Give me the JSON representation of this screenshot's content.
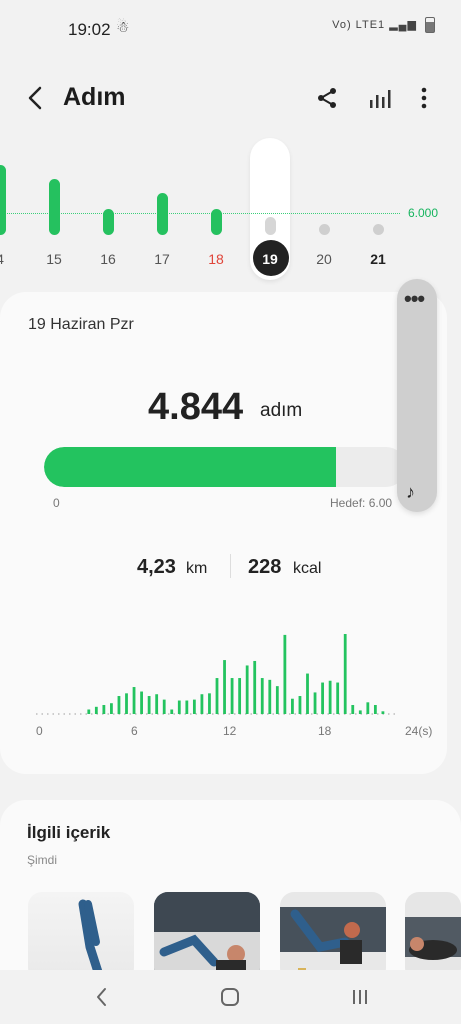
{
  "status": {
    "time": "19:02",
    "person_icon": "person-icon",
    "right": "Vo) LTE1"
  },
  "header": {
    "title": "Adım"
  },
  "week": {
    "target_label": "6.000",
    "days": [
      {
        "label": "4",
        "level": 0.88
      },
      {
        "label": "15",
        "level": 0.7
      },
      {
        "label": "16",
        "level": 0.32
      },
      {
        "label": "17",
        "level": 0.53
      },
      {
        "label": "18",
        "level": 0.33
      },
      {
        "label": "19",
        "level": 0.81
      },
      {
        "label": "20",
        "level": 0
      },
      {
        "label": "21",
        "level": 0
      }
    ]
  },
  "day": {
    "date_label": "19 Haziran Pzr",
    "steps": "4.844",
    "steps_unit": "adım",
    "progress": 0.807,
    "progress_start": "0",
    "progress_goal": "Hedef: 6.00",
    "distance": "4,23",
    "distance_unit": "km",
    "calories": "228",
    "calories_unit": "kcal"
  },
  "hourly": {
    "x_labels": [
      "0",
      "6",
      "12",
      "18",
      "24(s)"
    ],
    "values": [
      0,
      0,
      0,
      0,
      0,
      0,
      0,
      0.5,
      0.8,
      1,
      1.2,
      2,
      2.3,
      3,
      2.5,
      2,
      2.2,
      1.6,
      0.5,
      1.5,
      1.5,
      1.6,
      2.2,
      2.3,
      4,
      6,
      4,
      4,
      5.4,
      5.9,
      4,
      3.8,
      3.1,
      8.8,
      1.7,
      2,
      4.5,
      2.4,
      3.5,
      3.7,
      3.5,
      8.9,
      1,
      0.4,
      1.3,
      1,
      0.3,
      0,
      0
    ]
  },
  "related": {
    "title": "İlgili içerik",
    "subtitle": "Şimdi"
  },
  "colors": {
    "accent": "#23c35f",
    "weekend": "#e0453a"
  }
}
